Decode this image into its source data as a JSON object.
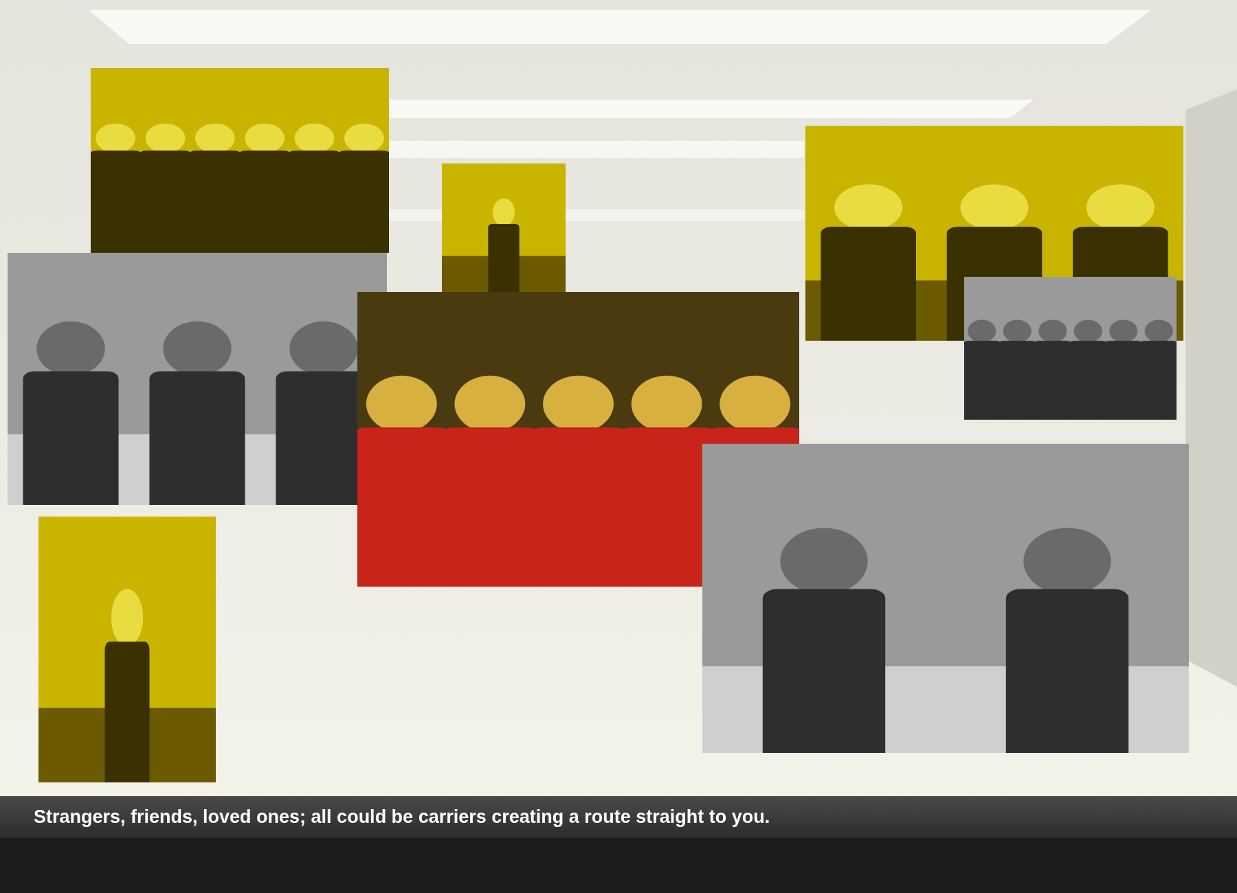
{
  "caption": "Strangers, friends, loved ones; all could be carriers creating a route straight to you."
}
